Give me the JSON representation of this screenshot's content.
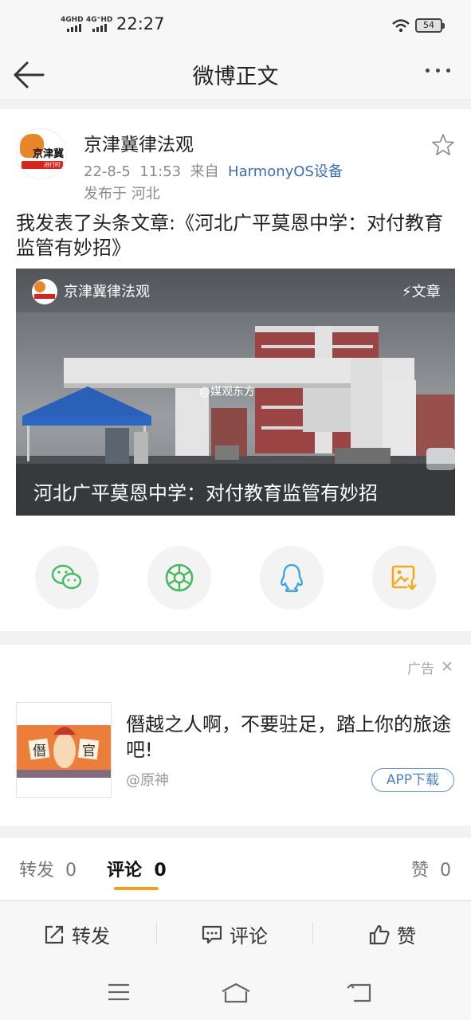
{
  "status_bar": {
    "sim1": "4GHD",
    "sim2": "4G⁺HD",
    "time": "22:27",
    "battery": "54"
  },
  "nav": {
    "title": "微博正文"
  },
  "post": {
    "author": "京津冀律法观",
    "avatar_text": "京津冀",
    "avatar_sub": "进行时",
    "date": "22-8-5",
    "time": "11:53",
    "from_label": "来自",
    "source": "HarmonyOS设备",
    "location": "发布于  河北",
    "text": "我发表了头条文章:《河北广平莫恩中学：对付教育监管有妙招》",
    "card": {
      "account": "京津冀律法观",
      "tag": "⚡文章",
      "watermark": "@媒观东方",
      "title": "河北广平莫恩中学：对付教育监管有妙招"
    }
  },
  "share_targets": [
    "wechat-icon",
    "moments-icon",
    "qq-icon",
    "save-image-icon"
  ],
  "ad": {
    "label": "广告",
    "close": "✕",
    "text": "僭越之人啊，不要驻足，踏上你的旅途吧!",
    "handle": "@原神",
    "button": "APP下载",
    "thumb_chars": [
      "僭",
      "官"
    ]
  },
  "tabs": {
    "repost_label": "转发",
    "repost_count": "0",
    "comment_label": "评论",
    "comment_count": "0",
    "like_label": "赞",
    "like_count": "0"
  },
  "actions": {
    "repost": "转发",
    "comment": "评论",
    "like": "赞"
  },
  "colors": {
    "link": "#3b6fb5",
    "accent_orange": "#f59c1a",
    "wechat_green": "#3fbf5a",
    "qq_blue": "#3aa3e8",
    "save_orange": "#f4a818"
  }
}
